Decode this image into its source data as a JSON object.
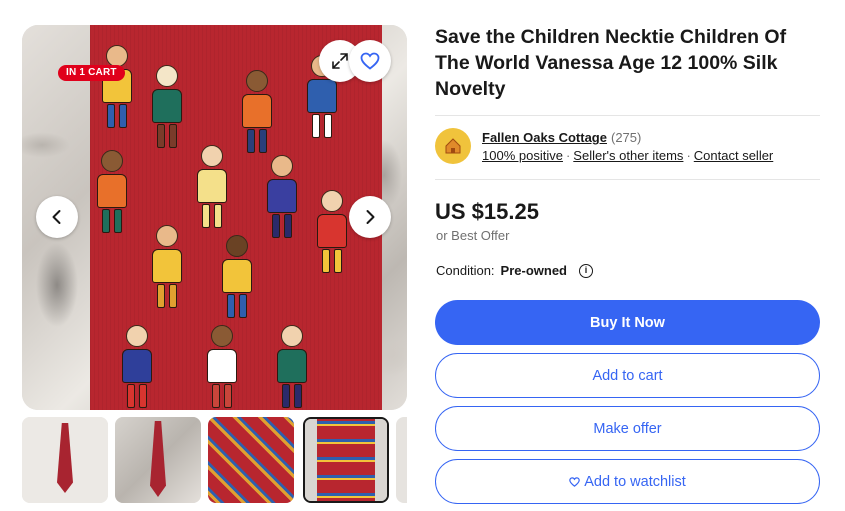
{
  "gallery": {
    "badge": "IN 1 CART",
    "thumbnails": [
      {
        "label": "thumbnail-1",
        "selected": false
      },
      {
        "label": "thumbnail-2",
        "selected": false
      },
      {
        "label": "thumbnail-3",
        "selected": false
      },
      {
        "label": "thumbnail-4",
        "selected": true
      }
    ]
  },
  "listing": {
    "title": "Save the Children Necktie Children Of The World Vanessa Age 12 100% Silk Novelty",
    "seller": {
      "name": "Fallen Oaks Cottage",
      "feedback_count": "(275)",
      "positive": "100% positive",
      "other_items": "Seller's other items",
      "contact": "Contact seller",
      "logo_color": "#f0c33c"
    },
    "price": "US $15.25",
    "best_offer": "or Best Offer",
    "condition_label": "Condition:",
    "condition_value": "Pre-owned",
    "info_icon": "i"
  },
  "actions": {
    "buy_now": "Buy It Now",
    "add_to_cart": "Add to cart",
    "make_offer": "Make offer",
    "add_to_watchlist": "Add to watchlist"
  },
  "colors": {
    "primary": "#3665f3",
    "badge": "#e0001b",
    "tie": "#b8262f"
  }
}
